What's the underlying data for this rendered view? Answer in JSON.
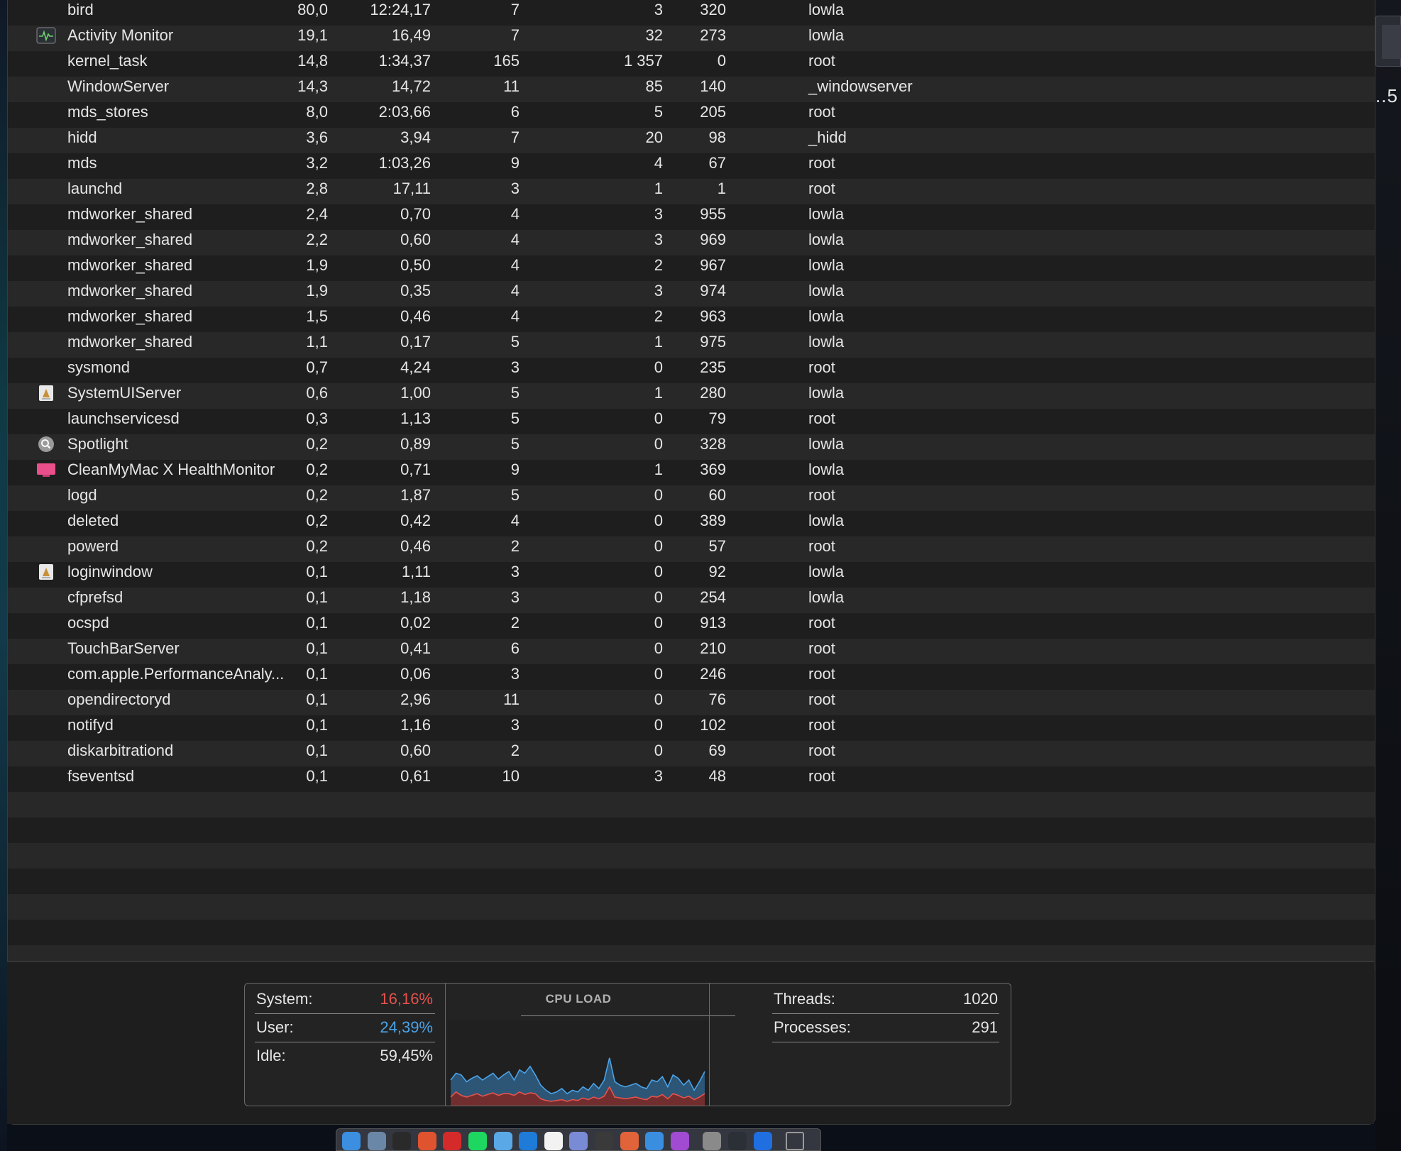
{
  "window": {
    "app": "Activity Monitor"
  },
  "processes": [
    {
      "name": "bird",
      "cpu": "80,0",
      "cpu_time": "12:24,17",
      "threads": "7",
      "idle_wakeups": "3",
      "pid": "320",
      "user": "lowla",
      "icon": ""
    },
    {
      "name": "Activity Monitor",
      "cpu": "19,1",
      "cpu_time": "16,49",
      "threads": "7",
      "idle_wakeups": "32",
      "pid": "273",
      "user": "lowla",
      "icon": "activity-monitor-icon"
    },
    {
      "name": "kernel_task",
      "cpu": "14,8",
      "cpu_time": "1:34,37",
      "threads": "165",
      "idle_wakeups": "1 357",
      "pid": "0",
      "user": "root",
      "icon": ""
    },
    {
      "name": "WindowServer",
      "cpu": "14,3",
      "cpu_time": "14,72",
      "threads": "11",
      "idle_wakeups": "85",
      "pid": "140",
      "user": "_windowserver",
      "icon": ""
    },
    {
      "name": "mds_stores",
      "cpu": "8,0",
      "cpu_time": "2:03,66",
      "threads": "6",
      "idle_wakeups": "5",
      "pid": "205",
      "user": "root",
      "icon": ""
    },
    {
      "name": "hidd",
      "cpu": "3,6",
      "cpu_time": "3,94",
      "threads": "7",
      "idle_wakeups": "20",
      "pid": "98",
      "user": "_hidd",
      "icon": ""
    },
    {
      "name": "mds",
      "cpu": "3,2",
      "cpu_time": "1:03,26",
      "threads": "9",
      "idle_wakeups": "4",
      "pid": "67",
      "user": "root",
      "icon": ""
    },
    {
      "name": "launchd",
      "cpu": "2,8",
      "cpu_time": "17,11",
      "threads": "3",
      "idle_wakeups": "1",
      "pid": "1",
      "user": "root",
      "icon": ""
    },
    {
      "name": "mdworker_shared",
      "cpu": "2,4",
      "cpu_time": "0,70",
      "threads": "4",
      "idle_wakeups": "3",
      "pid": "955",
      "user": "lowla",
      "icon": ""
    },
    {
      "name": "mdworker_shared",
      "cpu": "2,2",
      "cpu_time": "0,60",
      "threads": "4",
      "idle_wakeups": "3",
      "pid": "969",
      "user": "lowla",
      "icon": ""
    },
    {
      "name": "mdworker_shared",
      "cpu": "1,9",
      "cpu_time": "0,50",
      "threads": "4",
      "idle_wakeups": "2",
      "pid": "967",
      "user": "lowla",
      "icon": ""
    },
    {
      "name": "mdworker_shared",
      "cpu": "1,9",
      "cpu_time": "0,35",
      "threads": "4",
      "idle_wakeups": "3",
      "pid": "974",
      "user": "lowla",
      "icon": ""
    },
    {
      "name": "mdworker_shared",
      "cpu": "1,5",
      "cpu_time": "0,46",
      "threads": "4",
      "idle_wakeups": "2",
      "pid": "963",
      "user": "lowla",
      "icon": ""
    },
    {
      "name": "mdworker_shared",
      "cpu": "1,1",
      "cpu_time": "0,17",
      "threads": "5",
      "idle_wakeups": "1",
      "pid": "975",
      "user": "lowla",
      "icon": ""
    },
    {
      "name": "sysmond",
      "cpu": "0,7",
      "cpu_time": "4,24",
      "threads": "3",
      "idle_wakeups": "0",
      "pid": "235",
      "user": "root",
      "icon": ""
    },
    {
      "name": "SystemUIServer",
      "cpu": "0,6",
      "cpu_time": "1,00",
      "threads": "5",
      "idle_wakeups": "1",
      "pid": "280",
      "user": "lowla",
      "icon": "generic-app-icon"
    },
    {
      "name": "launchservicesd",
      "cpu": "0,3",
      "cpu_time": "1,13",
      "threads": "5",
      "idle_wakeups": "0",
      "pid": "79",
      "user": "root",
      "icon": ""
    },
    {
      "name": "Spotlight",
      "cpu": "0,2",
      "cpu_time": "0,89",
      "threads": "5",
      "idle_wakeups": "0",
      "pid": "328",
      "user": "lowla",
      "icon": "spotlight-icon"
    },
    {
      "name": "CleanMyMac X HealthMonitor",
      "cpu": "0,2",
      "cpu_time": "0,71",
      "threads": "9",
      "idle_wakeups": "1",
      "pid": "369",
      "user": "lowla",
      "icon": "cleanmymac-icon"
    },
    {
      "name": "logd",
      "cpu": "0,2",
      "cpu_time": "1,87",
      "threads": "5",
      "idle_wakeups": "0",
      "pid": "60",
      "user": "root",
      "icon": ""
    },
    {
      "name": "deleted",
      "cpu": "0,2",
      "cpu_time": "0,42",
      "threads": "4",
      "idle_wakeups": "0",
      "pid": "389",
      "user": "lowla",
      "icon": ""
    },
    {
      "name": "powerd",
      "cpu": "0,2",
      "cpu_time": "0,46",
      "threads": "2",
      "idle_wakeups": "0",
      "pid": "57",
      "user": "root",
      "icon": ""
    },
    {
      "name": "loginwindow",
      "cpu": "0,1",
      "cpu_time": "1,11",
      "threads": "3",
      "idle_wakeups": "0",
      "pid": "92",
      "user": "lowla",
      "icon": "generic-app-icon"
    },
    {
      "name": "cfprefsd",
      "cpu": "0,1",
      "cpu_time": "1,18",
      "threads": "3",
      "idle_wakeups": "0",
      "pid": "254",
      "user": "lowla",
      "icon": ""
    },
    {
      "name": "ocspd",
      "cpu": "0,1",
      "cpu_time": "0,02",
      "threads": "2",
      "idle_wakeups": "0",
      "pid": "913",
      "user": "root",
      "icon": ""
    },
    {
      "name": "TouchBarServer",
      "cpu": "0,1",
      "cpu_time": "0,41",
      "threads": "6",
      "idle_wakeups": "0",
      "pid": "210",
      "user": "root",
      "icon": ""
    },
    {
      "name": "com.apple.PerformanceAnaly...",
      "cpu": "0,1",
      "cpu_time": "0,06",
      "threads": "3",
      "idle_wakeups": "0",
      "pid": "246",
      "user": "root",
      "icon": ""
    },
    {
      "name": "opendirectoryd",
      "cpu": "0,1",
      "cpu_time": "2,96",
      "threads": "11",
      "idle_wakeups": "0",
      "pid": "76",
      "user": "root",
      "icon": ""
    },
    {
      "name": "notifyd",
      "cpu": "0,1",
      "cpu_time": "1,16",
      "threads": "3",
      "idle_wakeups": "0",
      "pid": "102",
      "user": "root",
      "icon": ""
    },
    {
      "name": "diskarbitrationd",
      "cpu": "0,1",
      "cpu_time": "0,60",
      "threads": "2",
      "idle_wakeups": "0",
      "pid": "69",
      "user": "root",
      "icon": ""
    },
    {
      "name": "fseventsd",
      "cpu": "0,1",
      "cpu_time": "0,61",
      "threads": "10",
      "idle_wakeups": "3",
      "pid": "48",
      "user": "root",
      "icon": ""
    }
  ],
  "summary": {
    "system_label": "System:",
    "system_value": "16,16%",
    "user_label": "User:",
    "user_value": "24,39%",
    "idle_label": "Idle:",
    "idle_value": "59,45%",
    "cpu_load_title": "CPU LOAD",
    "threads_label": "Threads:",
    "threads_value": "1020",
    "processes_label": "Processes:",
    "processes_value": "291"
  },
  "cpu_history": {
    "user_pct": [
      30,
      38,
      36,
      28,
      32,
      35,
      30,
      34,
      38,
      31,
      36,
      40,
      30,
      42,
      38,
      46,
      36,
      24,
      18,
      14,
      16,
      20,
      14,
      18,
      16,
      22,
      18,
      26,
      20,
      30,
      56,
      28,
      24,
      22,
      24,
      26,
      22,
      20,
      30,
      28,
      34,
      22,
      36,
      32,
      24,
      30,
      18,
      28,
      40
    ],
    "system_pct": [
      10,
      16,
      12,
      10,
      12,
      14,
      11,
      13,
      15,
      12,
      14,
      14,
      12,
      16,
      13,
      15,
      14,
      8,
      6,
      5,
      6,
      7,
      5,
      7,
      6,
      9,
      7,
      10,
      8,
      11,
      22,
      10,
      9,
      8,
      9,
      10,
      8,
      7,
      11,
      10,
      13,
      8,
      14,
      12,
      9,
      11,
      7,
      10,
      14
    ]
  },
  "dock": [
    "finder-icon",
    "preview-icon",
    "terminal-icon",
    "brave-icon",
    "creative-cloud-icon",
    "spotify-icon",
    "folder-icon",
    "vscode-icon",
    "calendar-icon",
    "discord-icon",
    "xcode-tool-icon",
    "affinity-publisher-icon",
    "affinity-designer-icon",
    "affinity-photo-icon",
    "system-preferences-icon",
    "activity-monitor-icon",
    "app-store-icon",
    "trash-icon"
  ],
  "peek": {
    "text": "..5"
  },
  "colors": {
    "system": "#e5534b",
    "user": "#4aa3e8",
    "row_alt": "#282828",
    "row": "#1e1e1e"
  }
}
